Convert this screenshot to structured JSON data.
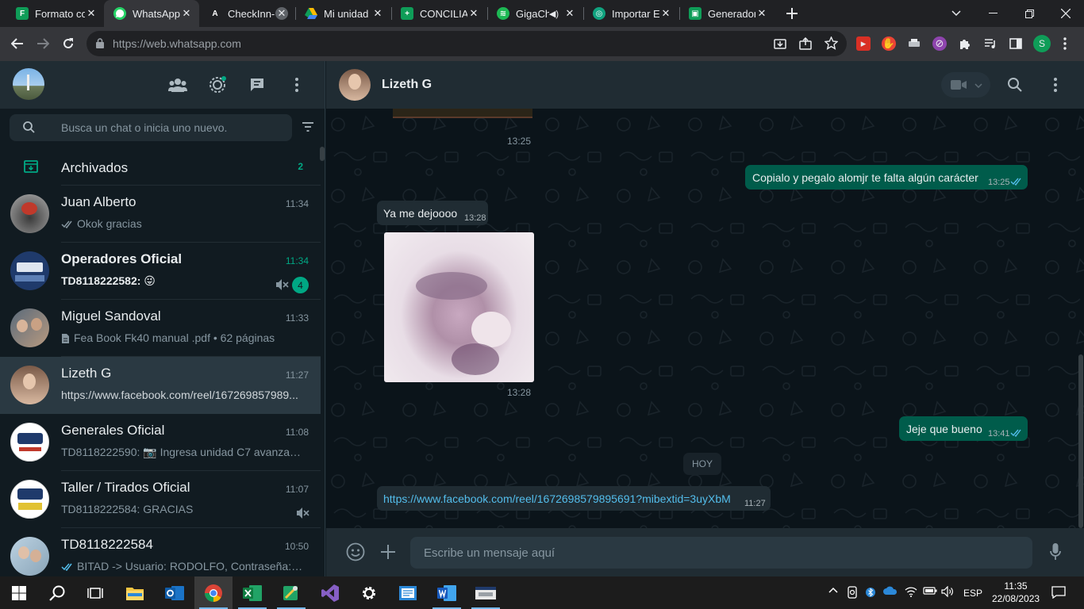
{
  "browser": {
    "tabs": [
      {
        "title": "Formato co",
        "favicon_color": "#0f9d58",
        "favicon_letter": "F"
      },
      {
        "title": "WhatsApp",
        "favicon_color": "#25d366",
        "favicon_letter": "W"
      },
      {
        "title": "CheckInn-I",
        "favicon_color": "#202124",
        "favicon_letter": "A"
      },
      {
        "title": "Mi unidad",
        "favicon_color": "#fbbc04",
        "favicon_letter": ""
      },
      {
        "title": "CONCILIAC",
        "favicon_color": "#0f9d58",
        "favicon_letter": "+"
      },
      {
        "title": "GigaCh",
        "favicon_color": "#1db954",
        "favicon_letter": "≋"
      },
      {
        "title": "Importar E",
        "favicon_color": "#10a37f",
        "favicon_letter": "◎"
      },
      {
        "title": "Generador",
        "favicon_color": "#0f9d58",
        "favicon_letter": "▣"
      }
    ],
    "url": "https://web.whatsapp.com"
  },
  "left_panel": {
    "search_placeholder": "Busca un chat o inicia uno nuevo.",
    "archived_label": "Archivados",
    "archived_count": "2",
    "chats": [
      {
        "name": "Juan Alberto",
        "time": "11:34",
        "preview": "Okok gracias",
        "ticks": true,
        "avatar_color": "#6d6d6d"
      },
      {
        "name": "Operadores Oficial",
        "time": "11:34",
        "preview": "TD8118222582: 😜",
        "bold": true,
        "unread": "4",
        "muted": true,
        "avatar_color": "#1f3a6b"
      },
      {
        "name": "Miguel Sandoval",
        "time": "11:33",
        "preview": "Fea Book Fk40 manual .pdf • 62 páginas",
        "doc": true,
        "avatar_color": "#8a6d5a"
      },
      {
        "name": "Lizeth G",
        "time": "11:27",
        "preview": "https://www.facebook.com/reel/167269857989...",
        "selected": true,
        "avatar_color": "#c9a08a"
      },
      {
        "name": "Generales Oficial",
        "time": "11:08",
        "preview": "TD8118222590: 📷 Ingresa unidad C7 avanza ço...",
        "avatar_color": "#ffffff"
      },
      {
        "name": "Taller / Tirados Oficial",
        "time": "11:07",
        "preview": "TD8118222584: GRACIAS",
        "muted": true,
        "avatar_color": "#ffffff"
      },
      {
        "name": "TD8118222584",
        "time": "10:50",
        "preview": "BITAD -> Usuario: RODOLFO, Contraseña: Y...",
        "ticks": true,
        "avatar_color": "#9fb6c8"
      }
    ]
  },
  "conversation": {
    "contact_name": "Lizeth G",
    "messages": [
      {
        "type": "image_time",
        "time": "13:25"
      },
      {
        "type": "out",
        "text": "Copialo y pegalo alomjr te falta algún carácter",
        "time": "13:25"
      },
      {
        "type": "in",
        "text": "Ya me dejoooo",
        "time": "13:28"
      },
      {
        "type": "image",
        "time": "13:28"
      },
      {
        "type": "out",
        "text": "Jeje que bueno",
        "time": "13:41"
      },
      {
        "type": "date",
        "text": "HOY"
      },
      {
        "type": "in_link",
        "text": "https://www.facebook.com/reel/1672698579895691?mibextid=3uyXbM",
        "time": "11:27"
      }
    ],
    "input_placeholder": "Escribe un mensaje aquí"
  },
  "taskbar": {
    "language": "ESP",
    "time": "11:35",
    "date": "22/08/2023"
  }
}
